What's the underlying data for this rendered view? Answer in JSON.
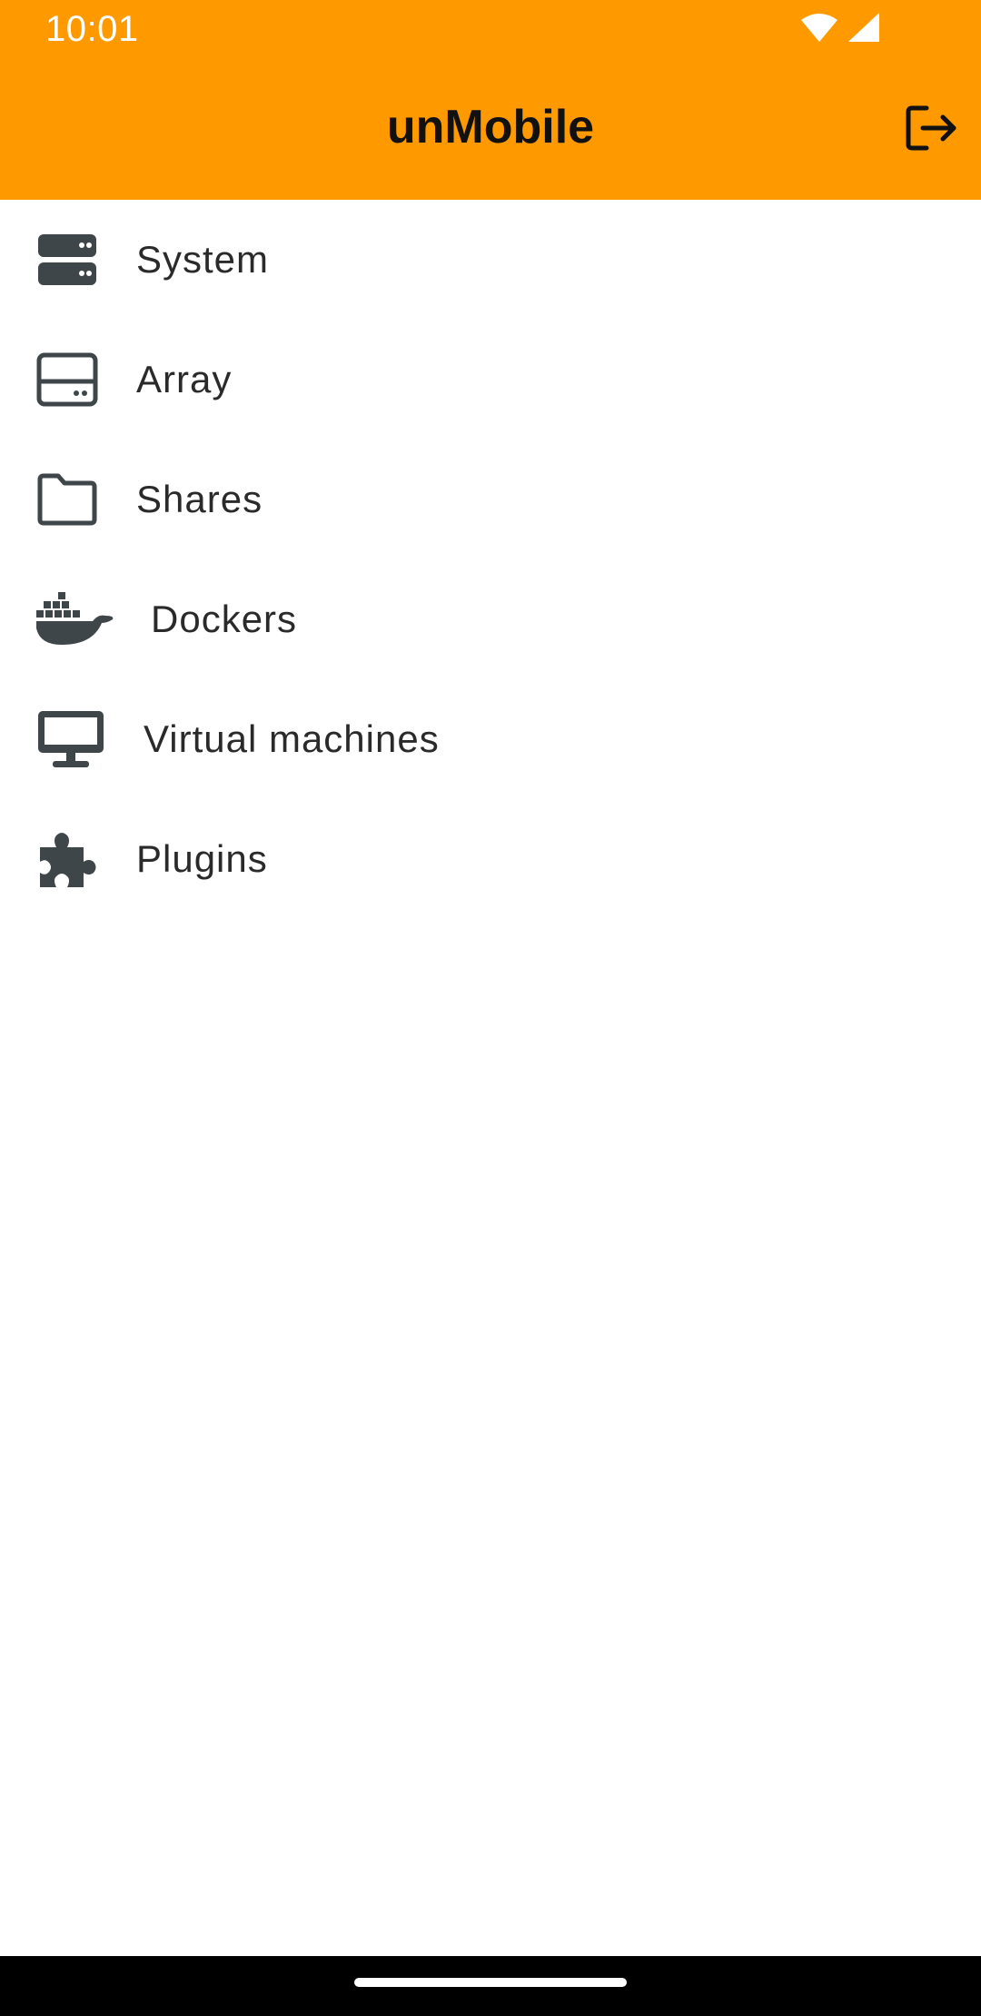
{
  "status_bar": {
    "time": "10:01",
    "icons": [
      "wifi-icon",
      "signal-icon"
    ]
  },
  "app_bar": {
    "title": "unMobile",
    "action_icon": "logout-icon",
    "background": "#ff9900"
  },
  "menu": {
    "items": [
      {
        "label": "System",
        "icon": "server-icon"
      },
      {
        "label": "Array",
        "icon": "hard-drive-icon"
      },
      {
        "label": "Shares",
        "icon": "folder-icon"
      },
      {
        "label": "Dockers",
        "icon": "docker-icon"
      },
      {
        "label": "Virtual machines",
        "icon": "desktop-monitor-icon"
      },
      {
        "label": "Plugins",
        "icon": "puzzle-icon"
      }
    ],
    "icon_color": "#3f464a"
  }
}
